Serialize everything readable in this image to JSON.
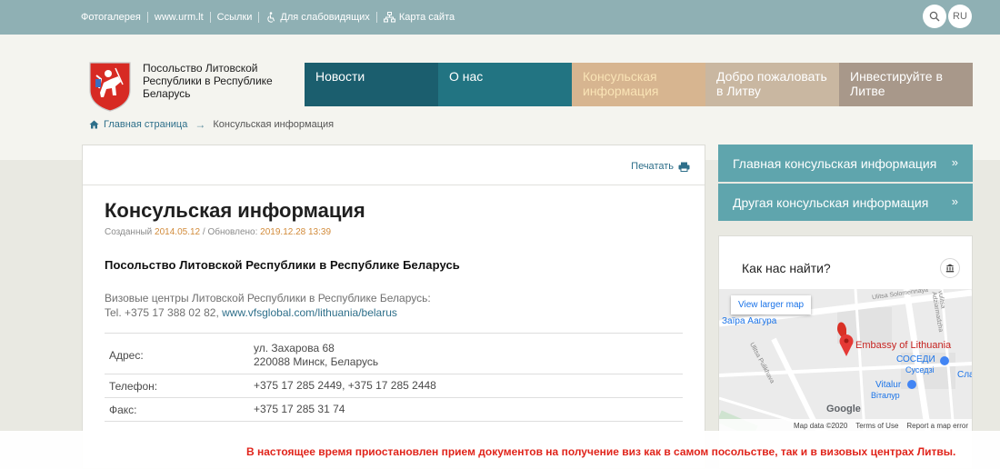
{
  "topbar": {
    "links": [
      "Фотогалерея",
      "www.urm.lt",
      "Ссылки",
      "Для слабовидящих",
      "Карта сайта"
    ],
    "lang": "RU"
  },
  "header": {
    "embassy_name": "Посольство Литовской Республики в Республике Беларусь",
    "nav": [
      {
        "label": "Новости",
        "color": "#1b5e6e"
      },
      {
        "label": "О нас",
        "color": "#227482"
      },
      {
        "label": "Консульская информация",
        "color": "#d7b590"
      },
      {
        "label": "Добро пожаловать в Литву",
        "color": "#c9b7a1"
      },
      {
        "label": "Инвестируйте в Литве",
        "color": "#a8988a"
      }
    ],
    "active_color": "#f4d29a"
  },
  "breadcrumb": {
    "home": "Главная страница",
    "current": "Консульская информация"
  },
  "content": {
    "print": "Печатать",
    "title": "Консульская информация",
    "created_label": "Созданный",
    "created_date": "2014.05.12",
    "updated_label": "/ Обновлено:",
    "updated_date": "2019.12.28 13:39",
    "section_title": "Посольство Литовской Республики в Республике Беларусь",
    "visa_line1": "Визовые центры Литовской Республики в Республике Беларусь:",
    "visa_tel": "Tel. +375 17 388 02 82,",
    "visa_link": "www.vfsglobal.com/lithuania/belarus",
    "rows": [
      {
        "label": "Адрес:",
        "value1": "ул. Захарова 68",
        "value2": "220088 Минск, Беларусь"
      },
      {
        "label": "Телефон:",
        "value1": "+375 17 285 2449, +375 17 285 2448",
        "value2": ""
      },
      {
        "label": "Факс:",
        "value1": "+375 17 285 31 74",
        "value2": ""
      }
    ]
  },
  "sidebar": {
    "buttons": [
      "Главная консульская информация",
      "Другая консульская информация"
    ],
    "arrow": "»",
    "map_title": "Как нас найти?",
    "map": {
      "view_larger": "View larger map",
      "embassy": "Embassy of Lithuania",
      "sosedi": "СОСЕДИ",
      "sosedi_sub": "Суседзi",
      "vitalur": "Vitalur",
      "vitalur_sub": "Віталур",
      "zaira": "Заїра Аагура",
      "street1": "Ulitsa Solomennaya",
      "street2": "Ulitsa Pulikhava",
      "street3": "vulitsa Adziarmadzha",
      "cla": "Сла",
      "google": "Google",
      "map_data": "Map data ©2020",
      "terms": "Terms of Use",
      "report": "Report a map error"
    }
  },
  "notice": "В настоящее время приостановлен прием документов на получение виз как в самом посольстве, так и в визовых центрах Литвы."
}
